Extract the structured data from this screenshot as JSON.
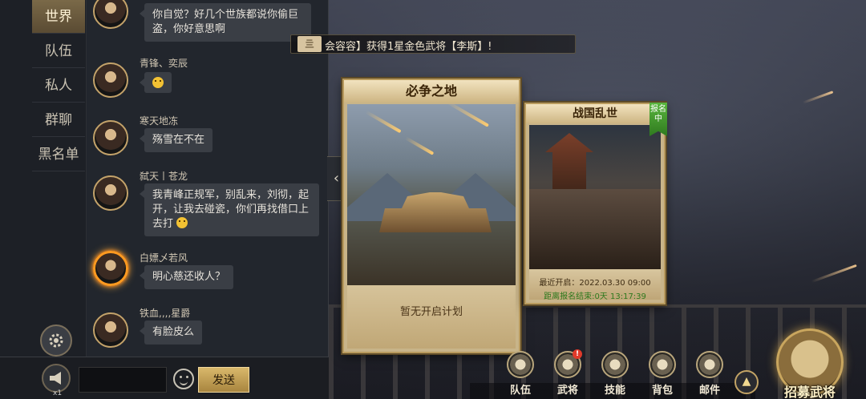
{
  "chat": {
    "tabs": [
      "世界",
      "队伍",
      "私人",
      "群聊",
      "黑名单"
    ],
    "messages": [
      {
        "user": "",
        "text": "你自觉？好几个世族都说你偷巨盗，你好意思啊"
      },
      {
        "user": "青锋、奕辰",
        "text": ""
      },
      {
        "user": "寒天地冻",
        "text": "殇雪在不在"
      },
      {
        "user": "弑天丨苍龙",
        "text": "我青峰正规军，别乱来，刘彻，起开，让我去碰瓷，你们再找借口上去打"
      },
      {
        "user": "白嫖乄若风",
        "text": "明心慈还收人？"
      },
      {
        "user": "铁血,,,,星爵",
        "text": "有脸皮么"
      }
    ],
    "mic_count": "x1",
    "input_value": "",
    "send_label": "发送"
  },
  "broadcast": {
    "icon_label": "亖",
    "text": "会容容】获得1星金色武将【李斯】!"
  },
  "cards": [
    {
      "title": "必争之地",
      "status": "暂无开启计划"
    },
    {
      "title": "战国乱世",
      "badge": "报名中",
      "open_time": "最近开启：2022.03.30 09:00",
      "countdown": "距离报名结束:0天 13:17:39"
    }
  ],
  "menu": {
    "items": [
      "队伍",
      "武将",
      "技能",
      "背包",
      "邮件"
    ],
    "alert": "!",
    "recruit_label": "招募武将"
  },
  "icons": {
    "gear": "gear-icon",
    "mic": "megaphone-icon",
    "emoji": "smiley-icon",
    "collapse": "chevron-left-icon",
    "up": "chevron-up-icon"
  },
  "colors": {
    "gold": "#c9a65e",
    "panel": "#22262d",
    "bubble": "#3a3e45",
    "badge_green": "#3f9a2a",
    "alert_red": "#e03a2a"
  }
}
